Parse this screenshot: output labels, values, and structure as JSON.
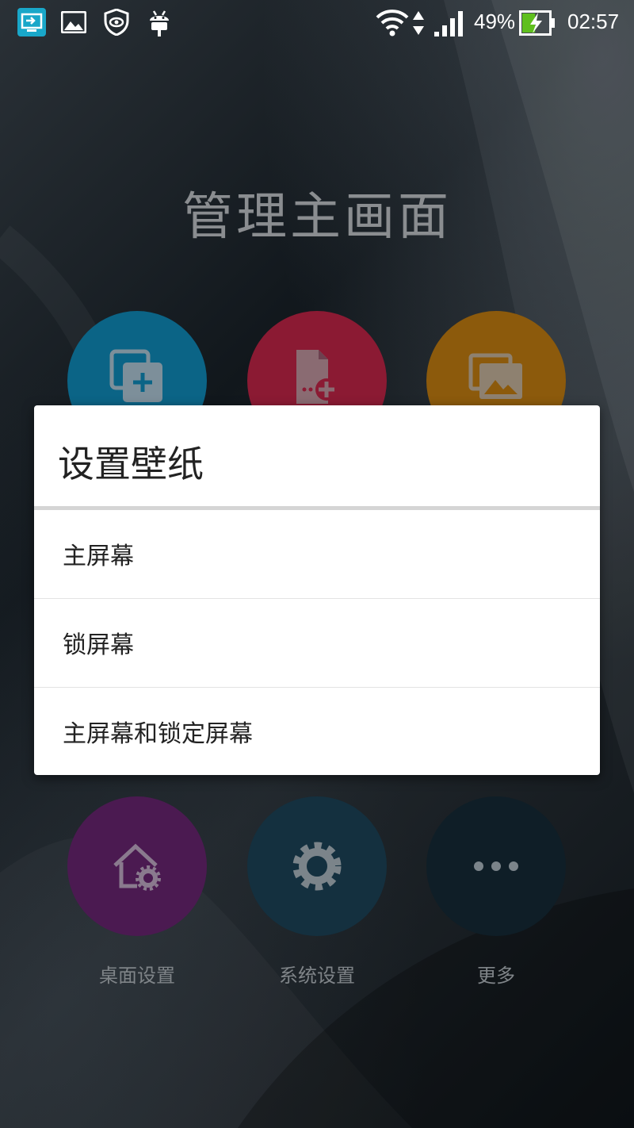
{
  "status_bar": {
    "battery_percent": "49%",
    "time": "02:57",
    "battery_level": 0.49,
    "icons": [
      "screen-cast-icon",
      "gallery-icon",
      "shield-eye-icon",
      "android-icon",
      "wifi-icon",
      "signal-icon",
      "battery-charging-icon"
    ]
  },
  "page": {
    "title": "管理主画面"
  },
  "tiles": {
    "top": [
      {
        "icon": "add-widget-icon",
        "color": "#0b6486"
      },
      {
        "icon": "add-app-icon",
        "color": "#8b1a33"
      },
      {
        "icon": "wallpaper-icon",
        "color": "#8c5a0c"
      }
    ],
    "bottom": [
      {
        "icon": "home-settings-icon",
        "color": "#4b1a51",
        "label": "桌面设置"
      },
      {
        "icon": "gear-icon",
        "color": "#14303f",
        "label": "系统设置"
      },
      {
        "icon": "more-icon",
        "color": "#0f1e27",
        "label": "更多"
      }
    ]
  },
  "dialog": {
    "title": "设置壁纸",
    "options": [
      {
        "label": "主屏幕"
      },
      {
        "label": "锁屏幕"
      },
      {
        "label": "主屏幕和锁定屏幕"
      }
    ]
  }
}
